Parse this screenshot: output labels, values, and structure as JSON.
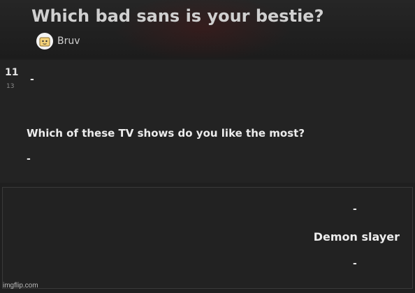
{
  "quiz": {
    "title": "Which bad sans is your bestie?",
    "author": "Bruv"
  },
  "question": {
    "number": "11",
    "total": "13",
    "top_dash": "-",
    "text": "Which of these TV shows do you like the most?",
    "bottom_dash": "-"
  },
  "answer": {
    "dash_above": "-",
    "label": "Demon slayer",
    "dash_below": "-"
  },
  "watermark": "imgflip.com",
  "icons": {
    "avatar": "bread-avatar-icon"
  }
}
